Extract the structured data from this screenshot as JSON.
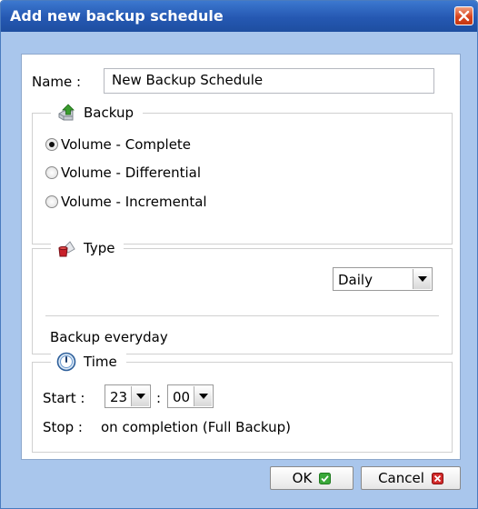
{
  "dialog": {
    "title": "Add new backup schedule",
    "close_icon": "close-x-icon"
  },
  "name": {
    "label": "Name :",
    "value": "New Backup Schedule"
  },
  "backup": {
    "legend": "Backup",
    "icon": "backup-upload-icon",
    "options": [
      {
        "label": "Volume - Complete",
        "checked": true
      },
      {
        "label": "Volume - Differential",
        "checked": false
      },
      {
        "label": "Volume - Incremental",
        "checked": false
      }
    ]
  },
  "type": {
    "legend": "Type",
    "icon": "bucket-icon",
    "selected": "Daily",
    "description": "Backup everyday"
  },
  "time": {
    "legend": "Time",
    "icon": "clock-icon",
    "start_label": "Start :",
    "start_hour": "23",
    "separator": ":",
    "start_minute": "00",
    "stop_label": "Stop :",
    "stop_value": "on completion (Full Backup)"
  },
  "buttons": {
    "ok": "OK",
    "cancel": "Cancel"
  },
  "colors": {
    "title_bar": "#2558b2",
    "dialog_bg": "#a9c6ec",
    "ok_check": "#3aa83a",
    "cancel_x": "#d22b2b"
  }
}
